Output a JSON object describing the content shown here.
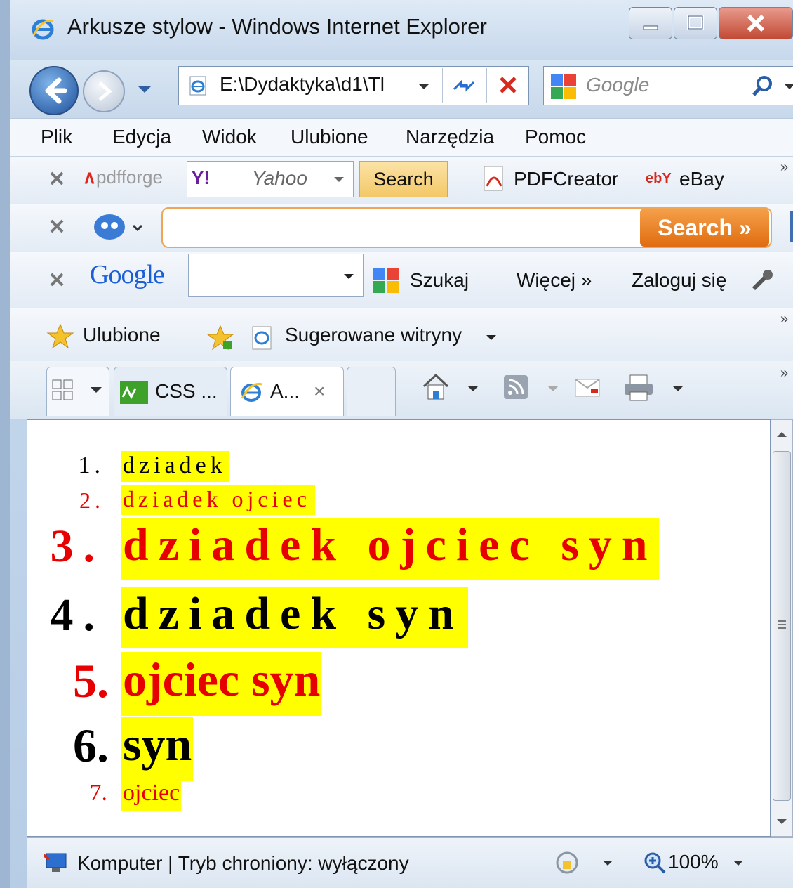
{
  "window": {
    "title": "Arkusze stylow - Windows Internet Explorer",
    "buttons": {
      "minimize": "minimize",
      "maximize": "maximize",
      "close": "close"
    }
  },
  "navigation": {
    "address": "E:\\Dydaktyka\\d1\\Tl",
    "search_placeholder": "Google"
  },
  "menu": [
    "Plik",
    "Edycja",
    "Widok",
    "Ulubione",
    "Narzędzia",
    "Pomoc"
  ],
  "toolbar1": {
    "brand": "pdfforge",
    "yahoo_logo": "Y!",
    "yahoo_text": "Yahoo",
    "search_button": "Search",
    "pdfcreator": "PDFCreator",
    "ebay_logo": "ebY",
    "ebay": "eBay",
    "more": "»"
  },
  "toolbar2": {
    "search_button": "Search »"
  },
  "toolbar3": {
    "google_logo": "Google",
    "szukaj": "Szukaj",
    "wiecej": "Więcej »",
    "zaloguj": "Zaloguj się"
  },
  "favorites": {
    "ulubione": "Ulubione",
    "sugerowane": "Sugerowane witryny",
    "more": "»"
  },
  "tabs": [
    {
      "label": "CSS ..."
    },
    {
      "label": "A...",
      "close": "×"
    }
  ],
  "list": [
    {
      "num": "1.",
      "text": "dziadek"
    },
    {
      "num": "2.",
      "text": "dziadek ojciec"
    },
    {
      "num": "3.",
      "text": "dziadek ojciec syn"
    },
    {
      "num": "4.",
      "text": "dziadek syn"
    },
    {
      "num": "5.",
      "text": "ojciec syn"
    },
    {
      "num": "6.",
      "text": "syn"
    },
    {
      "num": "7.",
      "text": "ojciec"
    }
  ],
  "status": {
    "zone": "Komputer | Tryb chroniony: wyłączony",
    "zoom": "100%"
  },
  "colors": {
    "highlight": "#ffff00",
    "red_text": "#e60000",
    "black_text": "#000000"
  }
}
